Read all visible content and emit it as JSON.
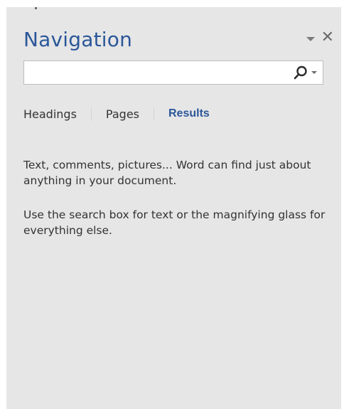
{
  "pane": {
    "title": "Navigation",
    "actions": [
      {
        "name": "pane-options-dropdown-icon"
      },
      {
        "name": "close-icon",
        "glyph": "✕"
      }
    ]
  },
  "search": {
    "value": "",
    "placeholder": "",
    "icon": "magnifier-icon",
    "dropdown_icon": "chevron-down-icon"
  },
  "tabs": [
    {
      "label": "Headings",
      "active": false
    },
    {
      "label": "Pages",
      "active": false
    },
    {
      "label": "Results",
      "active": true
    }
  ],
  "messages": [
    "Text, comments, pictures... Word can find just about anything in your document.",
    "Use the search box for text or the magnifying glass for everything else."
  ],
  "colors": {
    "accent": "#2b579a",
    "pane_bg": "#e6e6e6",
    "text": "#333333"
  }
}
